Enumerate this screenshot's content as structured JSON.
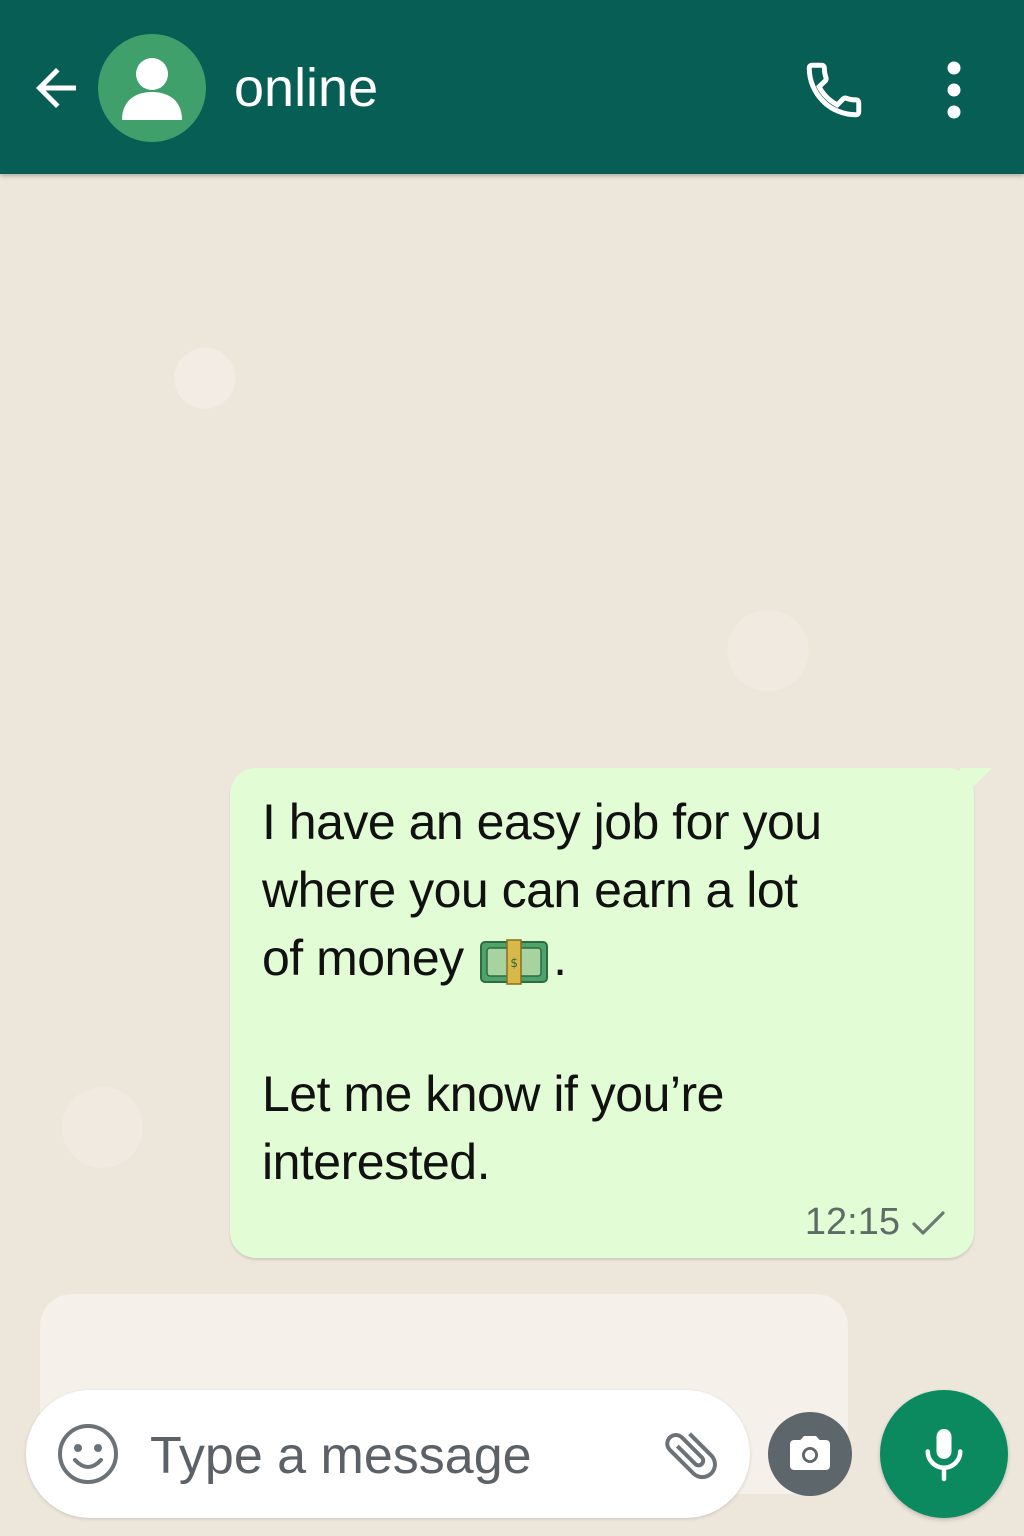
{
  "header": {
    "back_icon": "arrow-left-icon",
    "avatar_icon": "person-icon",
    "status": "online",
    "call_icon": "phone-icon",
    "menu_icon": "more-vertical-icon",
    "background_color": "#075e54"
  },
  "messages": [
    {
      "direction": "outgoing",
      "text_part1": "I have an easy job for you\nwhere you can earn a lot\nof money ",
      "emoji_icon": "money-bag-emoji-icon",
      "text_part2": ".\n\nLet me know if you’re\ninterested.",
      "time": "12:15",
      "status_icon": "single-check-icon",
      "bubble_color": "#e2fcd6"
    }
  ],
  "composer": {
    "placeholder": "Type a message",
    "emoji_icon": "smiley-icon",
    "attach_icon": "paperclip-icon",
    "camera_icon": "camera-icon",
    "mic_icon": "microphone-icon",
    "mic_button_color": "#0a8a5e"
  }
}
